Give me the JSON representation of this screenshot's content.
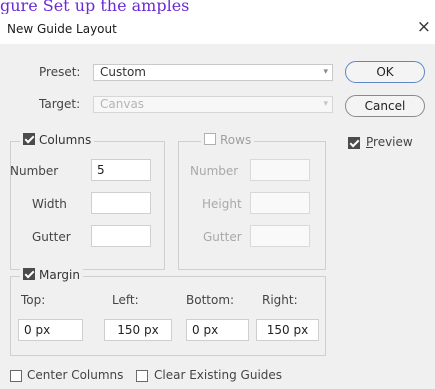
{
  "caption_top": "gure Set up the     amples",
  "dialog": {
    "title": "New Guide Layout",
    "close_glyph": "×"
  },
  "preset": {
    "label": "Preset:",
    "value": "Custom"
  },
  "target": {
    "label": "Target:",
    "value": "Canvas"
  },
  "buttons": {
    "ok": "OK",
    "cancel": "Cancel"
  },
  "preview": {
    "label": "Preview",
    "checked": true
  },
  "columns": {
    "label": "Columns",
    "checked": true,
    "number_label": "Number",
    "number_value": "5",
    "width_label": "Width",
    "width_value": "",
    "gutter_label": "Gutter",
    "gutter_value": ""
  },
  "rows": {
    "label": "Rows",
    "checked": false,
    "number_label": "Number",
    "number_value": "",
    "height_label": "Height",
    "height_value": "",
    "gutter_label": "Gutter",
    "gutter_value": ""
  },
  "margin": {
    "label": "Margin",
    "checked": true,
    "top_label": "Top:",
    "top_value": "0 px",
    "left_label": "Left:",
    "left_value": "150 px",
    "bottom_label": "Bottom:",
    "bottom_value": "0 px",
    "right_label": "Right:",
    "right_value": "150 px"
  },
  "center_columns": {
    "label": "Center Columns",
    "checked": false
  },
  "clear_existing": {
    "label": "Clear Existing Guides",
    "checked": false
  },
  "colors": {
    "caption": "#6a2bd6",
    "ok_border": "#5e87c4",
    "dialog_bg": "#f0f0f0"
  }
}
